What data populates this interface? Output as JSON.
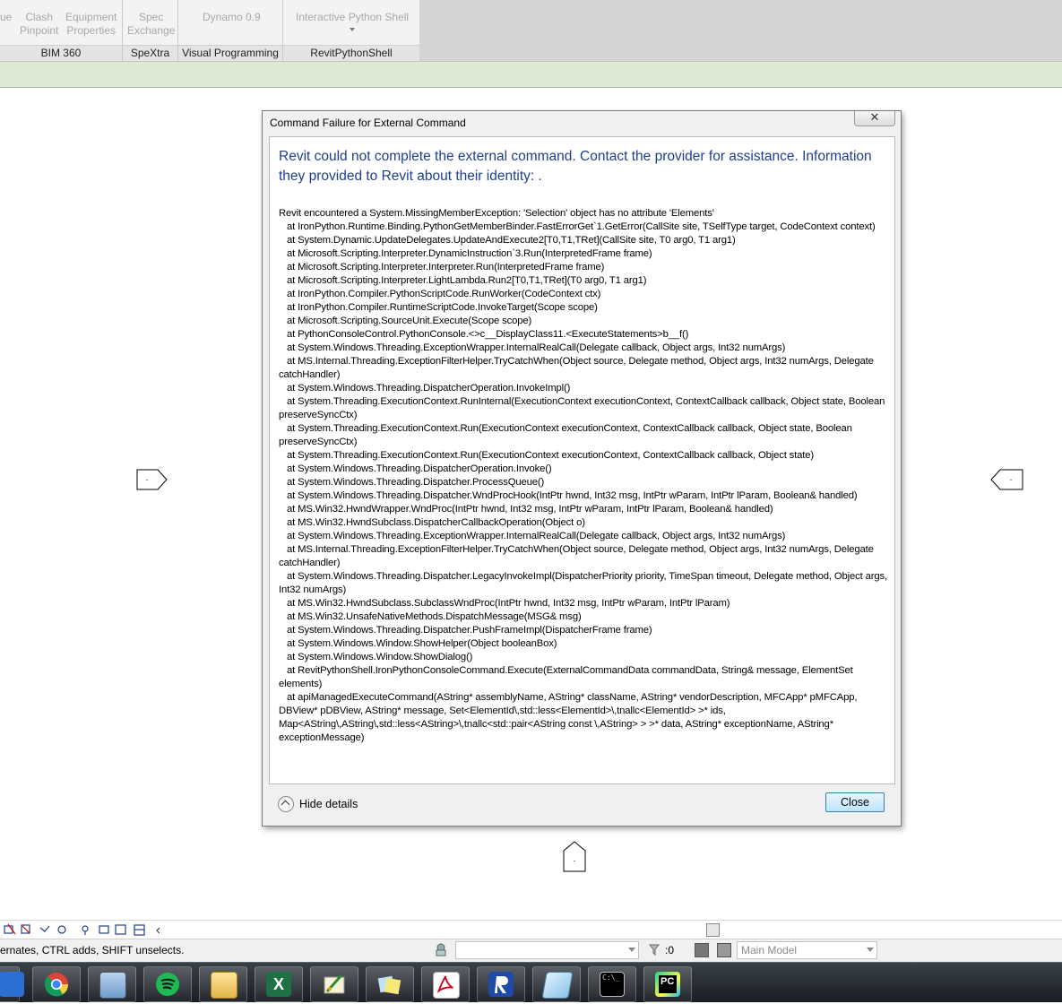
{
  "ribbon": {
    "partial_left_label": "ue",
    "groups": [
      {
        "label": "BIM 360",
        "buttons": [
          {
            "line1": "Clash",
            "line2": "Pinpoint"
          },
          {
            "line1": "Equipment",
            "line2": "Properties"
          }
        ]
      },
      {
        "label": "SpeXtra",
        "buttons": [
          {
            "line1": "Spec",
            "line2": "Exchange"
          }
        ]
      },
      {
        "label": "Visual Programming",
        "buttons": [
          {
            "line1": "Dynamo 0.9",
            "line2": ""
          }
        ]
      },
      {
        "label": "RevitPythonShell",
        "buttons": [
          {
            "line1": "Interactive Python Shell",
            "line2": ""
          }
        ]
      }
    ]
  },
  "dialog": {
    "title": "Command Failure for External Command",
    "close_glyph": "✕",
    "main_message": "Revit could not complete the external command. Contact the provider for assistance.  Information they provided to Revit about their identity: .",
    "details": "Revit encountered a System.MissingMemberException: 'Selection' object has no attribute 'Elements'\n   at IronPython.Runtime.Binding.PythonGetMemberBinder.FastErrorGet`1.GetError(CallSite site, TSelfType target, CodeContext context)\n   at System.Dynamic.UpdateDelegates.UpdateAndExecute2[T0,T1,TRet](CallSite site, T0 arg0, T1 arg1)\n   at Microsoft.Scripting.Interpreter.DynamicInstruction`3.Run(InterpretedFrame frame)\n   at Microsoft.Scripting.Interpreter.Interpreter.Run(InterpretedFrame frame)\n   at Microsoft.Scripting.Interpreter.LightLambda.Run2[T0,T1,TRet](T0 arg0, T1 arg1)\n   at IronPython.Compiler.PythonScriptCode.RunWorker(CodeContext ctx)\n   at IronPython.Compiler.RuntimeScriptCode.InvokeTarget(Scope scope)\n   at Microsoft.Scripting.SourceUnit.Execute(Scope scope)\n   at PythonConsoleControl.PythonConsole.<>c__DisplayClass11.<ExecuteStatements>b__f()\n   at System.Windows.Threading.ExceptionWrapper.InternalRealCall(Delegate callback, Object args, Int32 numArgs)\n   at MS.Internal.Threading.ExceptionFilterHelper.TryCatchWhen(Object source, Delegate method, Object args, Int32 numArgs, Delegate catchHandler)\n   at System.Windows.Threading.DispatcherOperation.InvokeImpl()\n   at System.Threading.ExecutionContext.RunInternal(ExecutionContext executionContext, ContextCallback callback, Object state, Boolean preserveSyncCtx)\n   at System.Threading.ExecutionContext.Run(ExecutionContext executionContext, ContextCallback callback, Object state, Boolean preserveSyncCtx)\n   at System.Threading.ExecutionContext.Run(ExecutionContext executionContext, ContextCallback callback, Object state)\n   at System.Windows.Threading.DispatcherOperation.Invoke()\n   at System.Windows.Threading.Dispatcher.ProcessQueue()\n   at System.Windows.Threading.Dispatcher.WndProcHook(IntPtr hwnd, Int32 msg, IntPtr wParam, IntPtr lParam, Boolean& handled)\n   at MS.Win32.HwndWrapper.WndProc(IntPtr hwnd, Int32 msg, IntPtr wParam, IntPtr lParam, Boolean& handled)\n   at MS.Win32.HwndSubclass.DispatcherCallbackOperation(Object o)\n   at System.Windows.Threading.ExceptionWrapper.InternalRealCall(Delegate callback, Object args, Int32 numArgs)\n   at MS.Internal.Threading.ExceptionFilterHelper.TryCatchWhen(Object source, Delegate method, Object args, Int32 numArgs, Delegate catchHandler)\n   at System.Windows.Threading.Dispatcher.LegacyInvokeImpl(DispatcherPriority priority, TimeSpan timeout, Delegate method, Object args, Int32 numArgs)\n   at MS.Win32.HwndSubclass.SubclassWndProc(IntPtr hwnd, Int32 msg, IntPtr wParam, IntPtr lParam)\n   at MS.Win32.UnsafeNativeMethods.DispatchMessage(MSG& msg)\n   at System.Windows.Threading.Dispatcher.PushFrameImpl(DispatcherFrame frame)\n   at System.Windows.Window.ShowHelper(Object booleanBox)\n   at System.Windows.Window.ShowDialog()\n   at RevitPythonShell.IronPythonConsoleCommand.Execute(ExternalCommandData commandData, String& message, ElementSet elements)\n   at apiManagedExecuteCommand(AString* assemblyName, AString* className, AString* vendorDescription, MFCApp* pMFCApp, DBView* pDBView, AString* message, Set<ElementId\\,std::less<ElementId>\\,tnallc<ElementId> >* ids, Map<AString\\,AString\\,std::less<AString>\\,tnallc<std::pair<AString const \\,AString> > >* data, AString* exceptionName, AString* exceptionMessage)",
    "hide_details_label": "Hide details",
    "close_label": "Close"
  },
  "canvas": {
    "marker_dot": "·"
  },
  "viewbar": {
    "icons": "⛌⛌⚯⚯♀⌸⌸⌸ ‹"
  },
  "statusbar": {
    "text": "ernates, CTRL adds, SHIFT unselects.",
    "selection_count": ":0",
    "model_label": "Main Model"
  },
  "taskbar": {
    "apps": [
      "mail-icon",
      "chrome-icon",
      "calculator-icon",
      "spotify-icon",
      "file-explorer-icon",
      "excel-icon",
      "paint-icon",
      "sticky-notes-icon",
      "acrobat-icon",
      "revit-icon",
      "notepad-icon",
      "cmd-icon",
      "pycharm-icon"
    ],
    "excel_letter": "X",
    "pycharm_letters": "PC",
    "cmd_prompt": "C:\\_"
  }
}
